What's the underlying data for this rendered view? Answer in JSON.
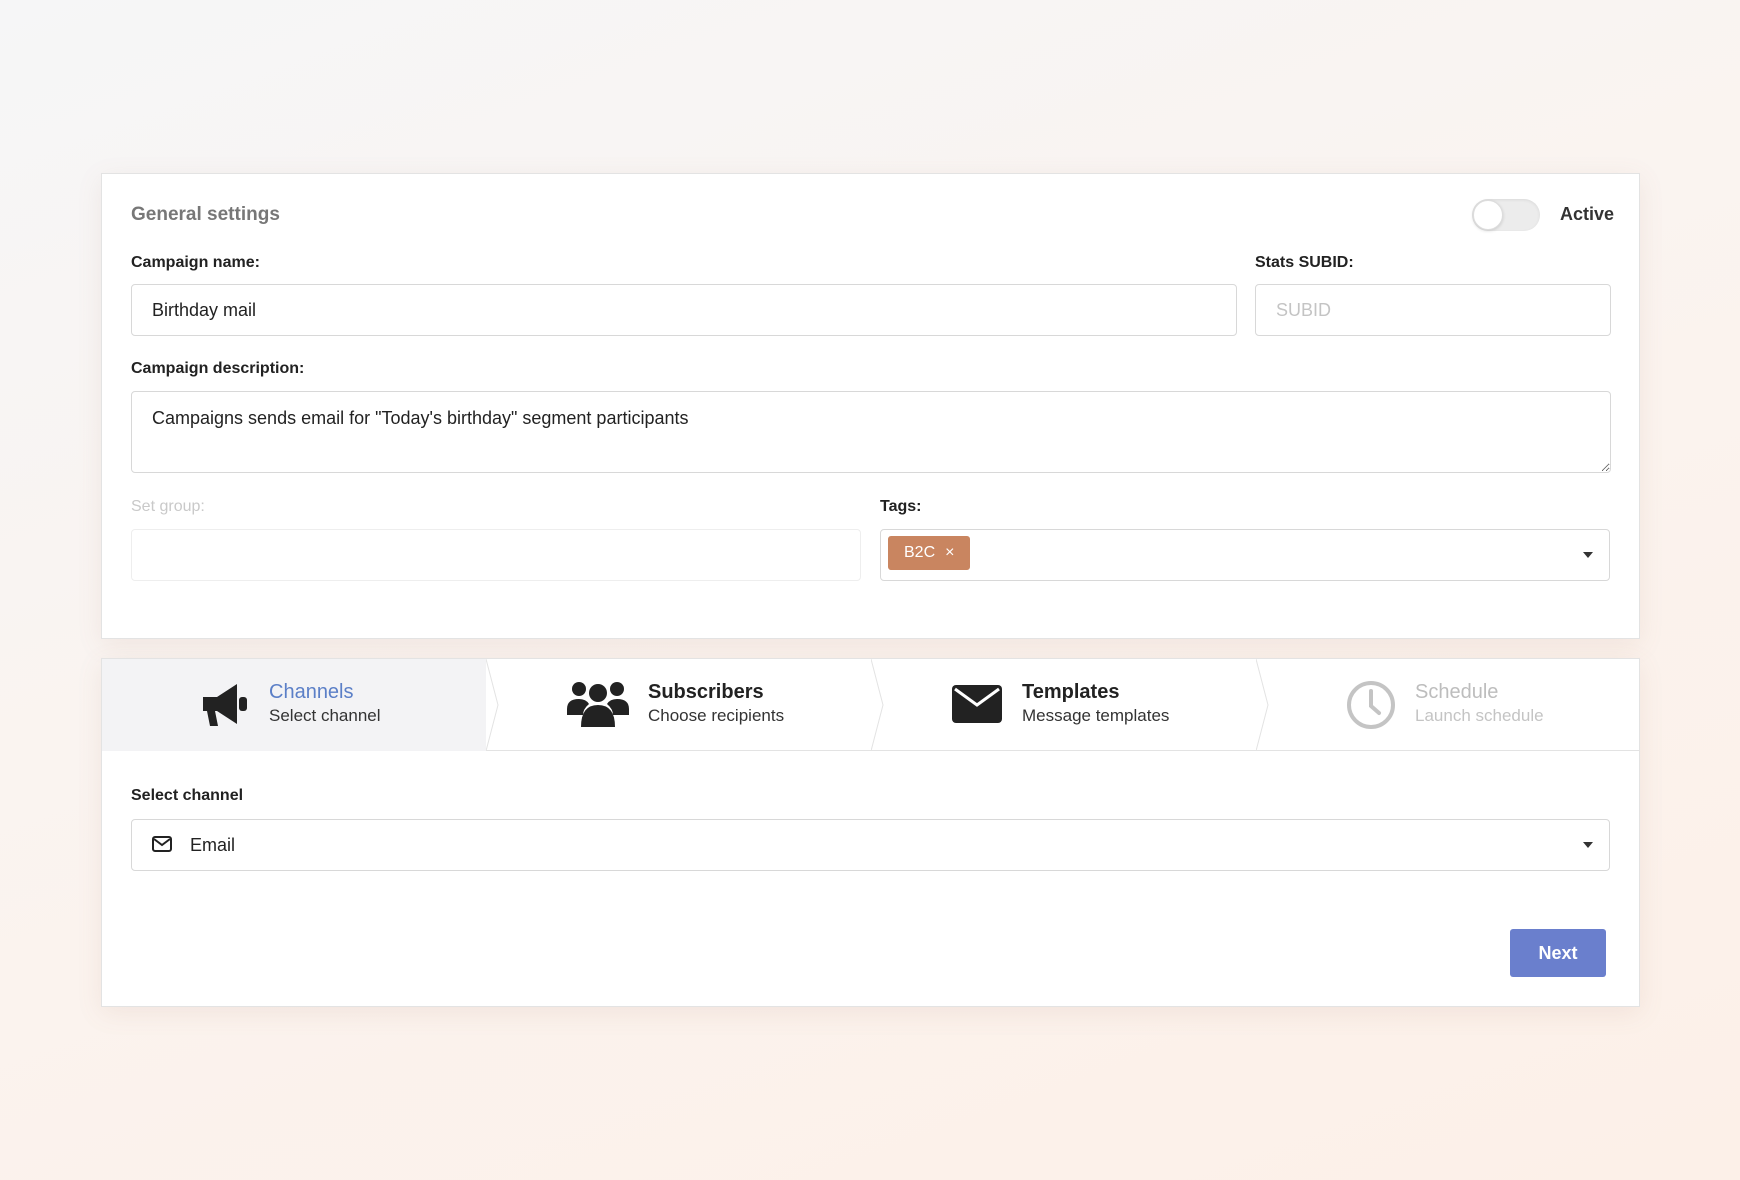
{
  "general": {
    "title": "General settings",
    "active_label": "Active",
    "active_on": false,
    "campaign_name": {
      "label": "Campaign name:",
      "value": "Birthday mail"
    },
    "stats_subid": {
      "label": "Stats SUBID:",
      "value": "",
      "placeholder": "SUBID"
    },
    "description": {
      "label": "Campaign description:",
      "value": "Campaigns sends email for \"Today's birthday\" segment participants"
    },
    "set_group": {
      "label": "Set group:",
      "value": ""
    },
    "tags": {
      "label": "Tags:",
      "items": [
        {
          "label": "B2C",
          "remove": "×",
          "color": "#c98560"
        }
      ]
    }
  },
  "steps": [
    {
      "title": "Channels",
      "subtitle": "Select channel",
      "icon": "megaphone-icon",
      "state": "active"
    },
    {
      "title": "Subscribers",
      "subtitle": "Choose recipients",
      "icon": "users-icon",
      "state": "default"
    },
    {
      "title": "Templates",
      "subtitle": "Message templates",
      "icon": "envelope-icon",
      "state": "default"
    },
    {
      "title": "Schedule",
      "subtitle": "Launch schedule",
      "icon": "clock-icon",
      "state": "disabled"
    }
  ],
  "channel": {
    "label": "Select channel",
    "value": "Email",
    "icon": "envelope-outline-icon"
  },
  "actions": {
    "next_label": "Next"
  },
  "colors": {
    "accent": "#6a7fcd",
    "active_step": "#5b7fc7",
    "tag": "#c98560"
  }
}
